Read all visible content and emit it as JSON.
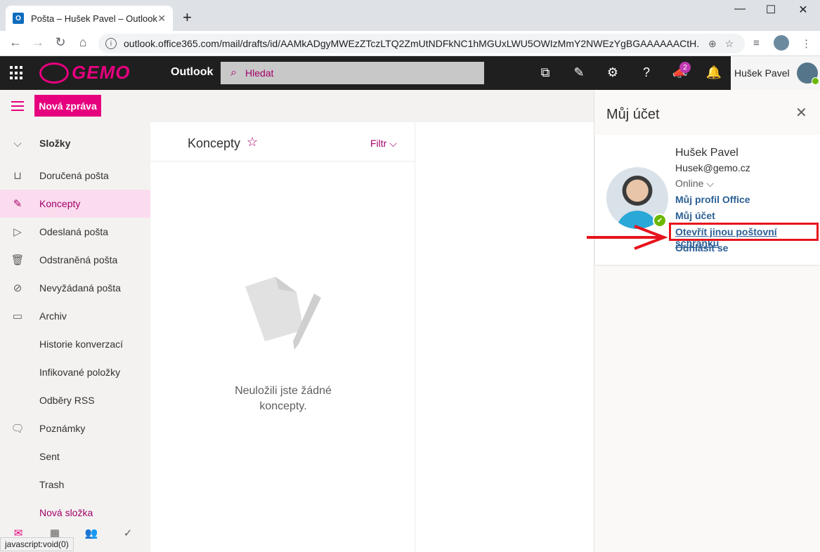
{
  "browser": {
    "tab_title": "Pošta – Hušek Pavel – Outlook",
    "url": "outlook.office365.com/mail/drafts/id/AAMkADgyMWEzZTczLTQ2ZmUtNDFkNC1hMGUxLWU5OWIzMmY2NWEzYgBGAAAAAACtH..."
  },
  "header": {
    "logo_text": "GEMO",
    "app_title": "Outlook",
    "search_placeholder": "Hledat",
    "notification_badge": "2",
    "user_name": "Hušek Pavel"
  },
  "command_bar": {
    "new_message_label": "Nová zpráva"
  },
  "folders": {
    "header": "Složky",
    "items": [
      {
        "label": "Doručená pošta",
        "icon": "inbox-icon"
      },
      {
        "label": "Koncepty",
        "icon": "pencil-icon",
        "selected": true
      },
      {
        "label": "Odeslaná pošta",
        "icon": "send-icon"
      },
      {
        "label": "Odstraněná pošta",
        "icon": "trash-icon"
      },
      {
        "label": "Nevyžádaná pošta",
        "icon": "block-icon"
      },
      {
        "label": "Archiv",
        "icon": "archive-icon"
      },
      {
        "label": "Historie konverzací",
        "icon": ""
      },
      {
        "label": "Infikované položky",
        "icon": ""
      },
      {
        "label": "Odběry RSS",
        "icon": ""
      },
      {
        "label": "Poznámky",
        "icon": "note-icon"
      },
      {
        "label": "Sent",
        "icon": ""
      },
      {
        "label": "Trash",
        "icon": ""
      },
      {
        "label": "Nová složka",
        "icon": ""
      }
    ]
  },
  "status_bar": "javascript:void(0)",
  "message_list": {
    "title": "Koncepty",
    "filter_label": "Filtr",
    "empty_text_line1": "Neuložili jste žádné",
    "empty_text_line2": "koncepty."
  },
  "account_panel": {
    "title": "Můj účet",
    "name": "Hušek Pavel",
    "email": "Husek@gemo.cz",
    "status": "Online",
    "links": {
      "office_profile": "Můj profil Office",
      "my_account": "Můj účet",
      "open_other_mailbox": "Otevřít jinou poštovní schránku",
      "sign_out": "Odhlásit se"
    }
  },
  "colors": {
    "accent": "#e6007e",
    "accent_dark": "#a4006a",
    "header_bg": "#1f1f1f",
    "link": "#2b5f95",
    "annotation_red": "#e6141c"
  }
}
